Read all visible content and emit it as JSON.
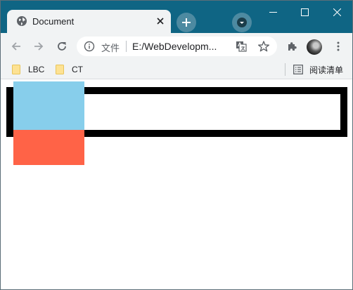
{
  "tab": {
    "title": "Document",
    "favicon": "globe-icon"
  },
  "toolbar": {
    "scheme_label": "文件",
    "url": "E:/WebDevelopm..."
  },
  "bookmarks": {
    "items": [
      {
        "label": "LBC",
        "icon": "folder-icon"
      },
      {
        "label": "CT",
        "icon": "folder-icon"
      }
    ],
    "reading_list_label": "阅读清单"
  },
  "colors": {
    "titlebar": "#0f6584",
    "toolbar": "#f1f3f4",
    "outer_border": "#000000",
    "blue_box": "#87ceeb",
    "red_box": "#ff6347"
  }
}
